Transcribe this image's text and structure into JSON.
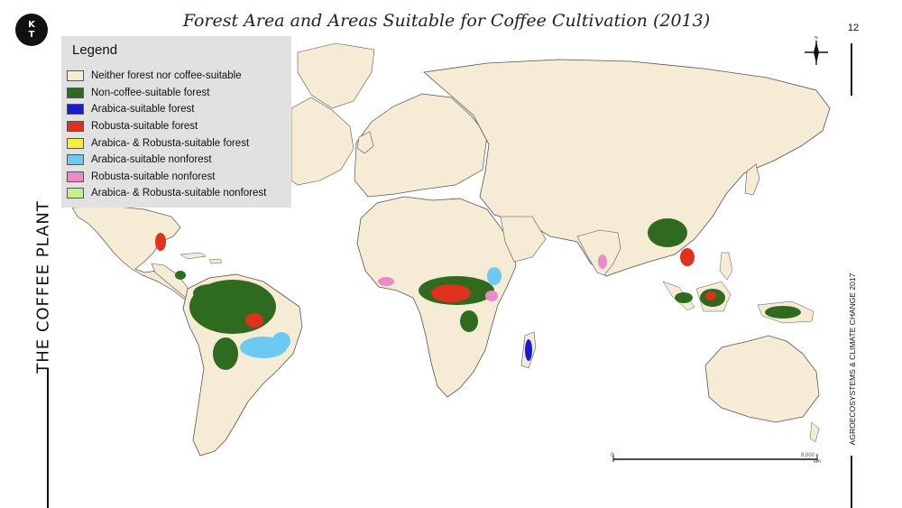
{
  "logo": {
    "line1": "K",
    "line2": "T"
  },
  "slide": {
    "side_title": "THE COFFEE PLANT",
    "page_number": "12",
    "side_caption": "AGROECOSYSTEMS & CLIMATE CHANGE 2017"
  },
  "map": {
    "title": "Forest Area and Areas Suitable for Coffee Cultivation (2013)",
    "compass_label": "N",
    "scale_start": "0",
    "scale_end": "8,000",
    "scale_unit": "km",
    "legend": {
      "title": "Legend",
      "items": [
        {
          "label": "Neither forest nor coffee-suitable",
          "color": "#f6ebd5"
        },
        {
          "label": "Non-coffee-suitable forest",
          "color": "#2e6b1f"
        },
        {
          "label": "Arabica-suitable forest",
          "color": "#1a1ad6"
        },
        {
          "label": "Robusta-suitable forest",
          "color": "#e0301e"
        },
        {
          "label": "Arabica- & Robusta-suitable forest",
          "color": "#f4ee3c"
        },
        {
          "label": "Arabica-suitable nonforest",
          "color": "#6cc9f2"
        },
        {
          "label": "Robusta-suitable nonforest",
          "color": "#ea8ac7"
        },
        {
          "label": "Arabica- & Robusta-suitable nonforest",
          "color": "#c4f08e"
        }
      ]
    }
  }
}
